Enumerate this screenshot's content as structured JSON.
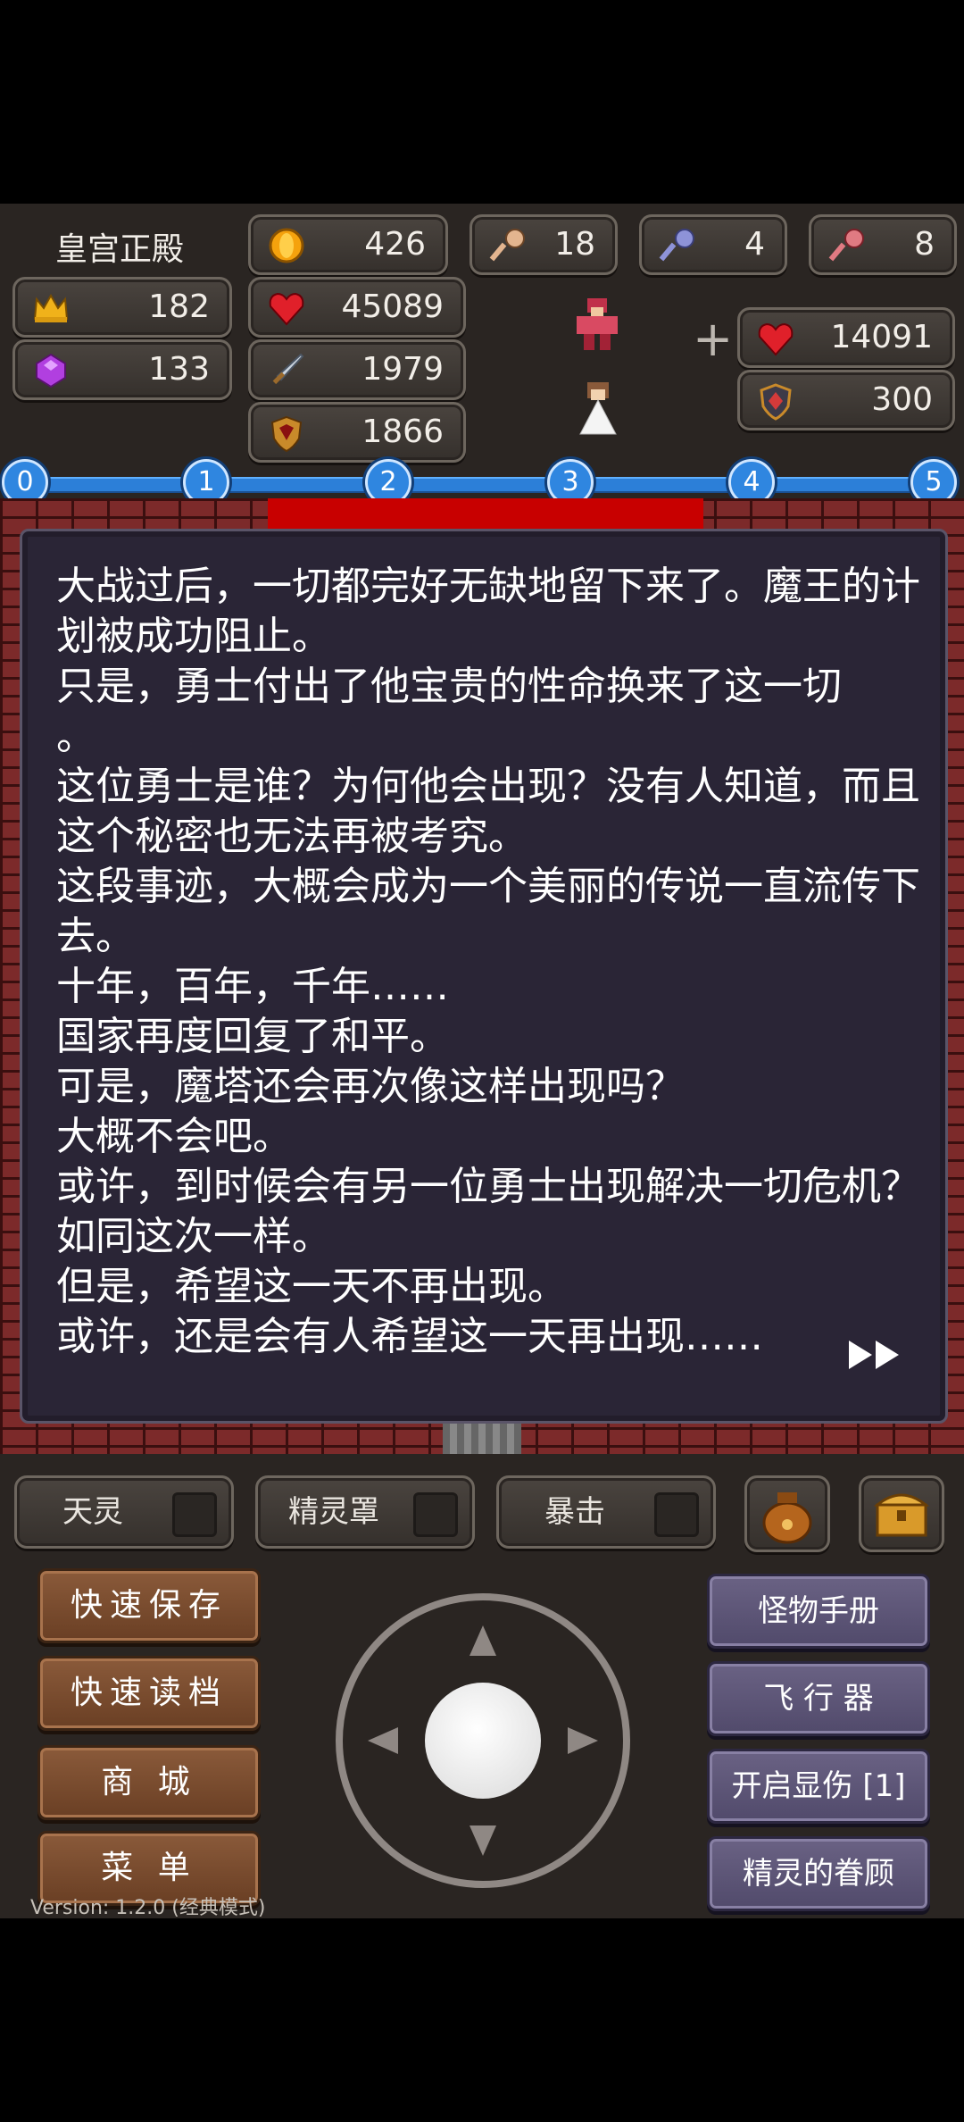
{
  "location": "皇宫正殿",
  "stats": {
    "level": "182",
    "gems": "133",
    "gold": "426",
    "hp": "45089",
    "attack": "1979",
    "defense": "1866",
    "key_yellow": "18",
    "key_blue": "4",
    "key_red": "8"
  },
  "target": {
    "hp": "14091",
    "defense": "300"
  },
  "progress": {
    "nodes": [
      "0",
      "1",
      "2",
      "3",
      "4",
      "5"
    ]
  },
  "dialog": {
    "text": "大战过后，一切都完好无缺地留下来了。魔王的计划被成功阻止。\n只是，勇士付出了他宝贵的性命换来了这一切\n。\n这位勇士是谁？为何他会出现？没有人知道，而且这个秘密也无法再被考究。\n这段事迹，大概会成为一个美丽的传说一直流传下去。\n十年，百年，千年……\n国家再度回复了和平。\n可是，魔塔还会再次像这样出现吗？\n大概不会吧。\n或许，到时候会有另一位勇士出现解决一切危机？如同这次一样。\n但是，希望这一天不再出现。\n或许，还是会有人希望这一天再出现……"
  },
  "skills": [
    {
      "label": "天灵"
    },
    {
      "label": "精灵罩"
    },
    {
      "label": "暴击"
    }
  ],
  "left_buttons": [
    "快速保存",
    "快速读档",
    "商  城",
    "菜  单"
  ],
  "right_buttons": [
    "怪物手册",
    "飞 行 器",
    "开启显伤 [1]",
    "精灵的眷顾"
  ],
  "version": "Version: 1.2.0 (经典模式)",
  "colors": {
    "bar_blue": "#2f86e0",
    "lava_red": "#c80000",
    "brick": "#7c2a2a",
    "dialog_bg": "#2a2536"
  }
}
